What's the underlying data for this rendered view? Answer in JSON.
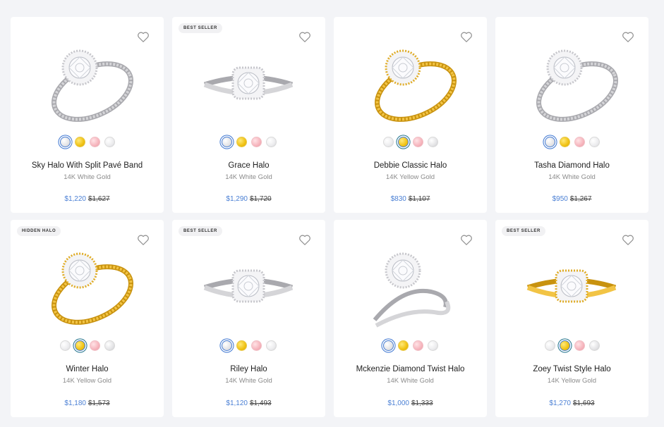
{
  "colors": {
    "price": "#4a7fd4",
    "selected_ring": "#4a7fd4",
    "background": "#f3f4f7"
  },
  "products": [
    {
      "name": "Sky Halo With Split Pavé Band",
      "metal": "14K White Gold",
      "price": "$1,220",
      "original_price": "$1,627",
      "badge": "",
      "selected_metal": 0,
      "ring_color": "white",
      "style": "split"
    },
    {
      "name": "Grace Halo",
      "metal": "14K White Gold",
      "price": "$1,290",
      "original_price": "$1,720",
      "badge": "BEST SELLER",
      "selected_metal": 0,
      "ring_color": "white",
      "style": "cushion"
    },
    {
      "name": "Debbie Classic Halo",
      "metal": "14K Yellow Gold",
      "price": "$830",
      "original_price": "$1,107",
      "badge": "",
      "selected_metal": 1,
      "ring_color": "yellow",
      "style": "round"
    },
    {
      "name": "Tasha Diamond Halo",
      "metal": "14K White Gold",
      "price": "$950",
      "original_price": "$1,267",
      "badge": "",
      "selected_metal": 0,
      "ring_color": "white",
      "style": "round"
    },
    {
      "name": "Winter Halo",
      "metal": "14K Yellow Gold",
      "price": "$1,180",
      "original_price": "$1,573",
      "badge": "HIDDEN HALO",
      "selected_metal": 1,
      "ring_color": "yellow",
      "style": "vintage"
    },
    {
      "name": "Riley Halo",
      "metal": "14K White Gold",
      "price": "$1,120",
      "original_price": "$1,493",
      "badge": "BEST SELLER",
      "selected_metal": 0,
      "ring_color": "white",
      "style": "cushion"
    },
    {
      "name": "Mckenzie Diamond Twist Halo",
      "metal": "14K White Gold",
      "price": "$1,000",
      "original_price": "$1,333",
      "badge": "",
      "selected_metal": 0,
      "ring_color": "white",
      "style": "twist"
    },
    {
      "name": "Zoey Twist Style Halo",
      "metal": "14K Yellow Gold",
      "price": "$1,270",
      "original_price": "$1,693",
      "badge": "BEST SELLER",
      "selected_metal": 1,
      "ring_color": "yellow",
      "style": "cushion"
    }
  ],
  "swatch_order_white": [
    "white",
    "yellow",
    "rose",
    "platinum"
  ],
  "swatch_order_yellow": [
    "platinum",
    "yellow",
    "rose",
    "white"
  ],
  "icons": {
    "wishlist": "heart-icon"
  }
}
